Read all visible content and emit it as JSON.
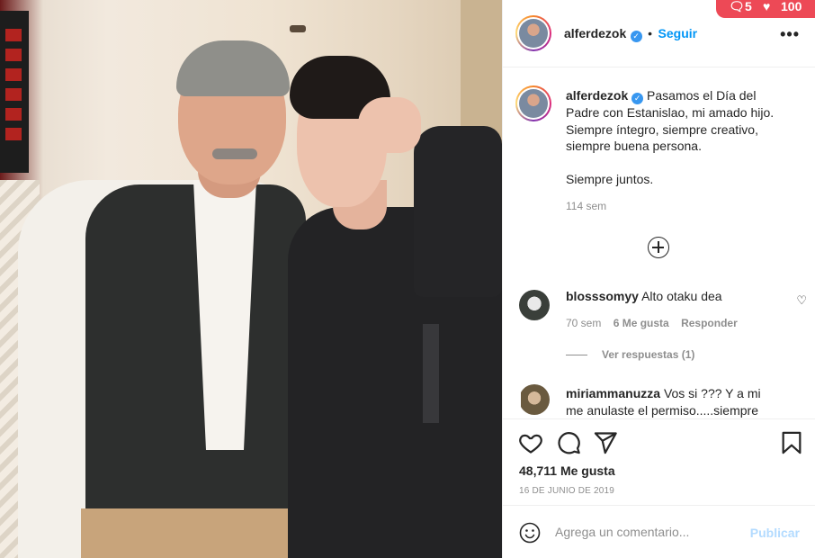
{
  "post": {
    "username": "alferdezok",
    "follow_label": "Seguir",
    "separator": "•",
    "more_label": "•••",
    "caption_lines": [
      "Pasamos el Día del",
      "Padre con Estanislao, mi amado hijo.",
      "Siempre íntegro, siempre creativo,",
      "siempre buena persona."
    ],
    "caption_extra": "Siempre juntos.",
    "caption_time": "114 sem"
  },
  "comments": [
    {
      "username": "blosssomyy",
      "text": "Alto otaku dea",
      "time": "70 sem",
      "likes": "6 Me gusta",
      "reply": "Responder",
      "view_replies": "Ver respuestas (1)"
    },
    {
      "username": "miriammanuzza",
      "text": "Vos si ??? Y a mi",
      "text_line2": "me anulaste el permiso.....siempre"
    }
  ],
  "actions": {
    "likes": "48,711 Me gusta",
    "date": "16 DE JUNIO DE 2019"
  },
  "add_comment": {
    "placeholder": "Agrega un comentario...",
    "publish_label": "Publicar"
  },
  "notifications": {
    "comments_count": "5",
    "likes_count": "100"
  },
  "colors": {
    "accent": "#0095f6",
    "verified": "#3897f0",
    "notification": "#ed4956",
    "publish_disabled": "#b3dbff"
  }
}
